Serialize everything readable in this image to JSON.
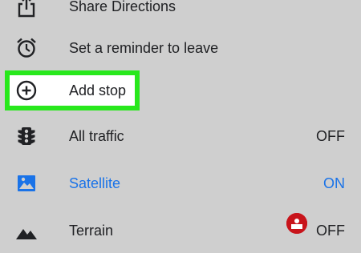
{
  "menu": {
    "share": {
      "label": "Share Directions",
      "icon": "share-icon"
    },
    "reminder": {
      "label": "Set a reminder to leave",
      "icon": "alarm-clock-icon"
    },
    "add_stop": {
      "label": "Add stop",
      "icon": "add-circle-icon"
    },
    "traffic": {
      "label": "All traffic",
      "state": "OFF",
      "icon": "traffic-light-icon"
    },
    "satellite": {
      "label": "Satellite",
      "state": "ON",
      "icon": "satellite-image-icon"
    },
    "terrain": {
      "label": "Terrain",
      "state": "OFF",
      "icon": "terrain-icon"
    }
  },
  "colors": {
    "background": "#cfcfcf",
    "accent": "#1a73e8",
    "highlight_border": "#28e81c"
  },
  "watermark": {
    "icon": "wikihow-badge-icon"
  }
}
